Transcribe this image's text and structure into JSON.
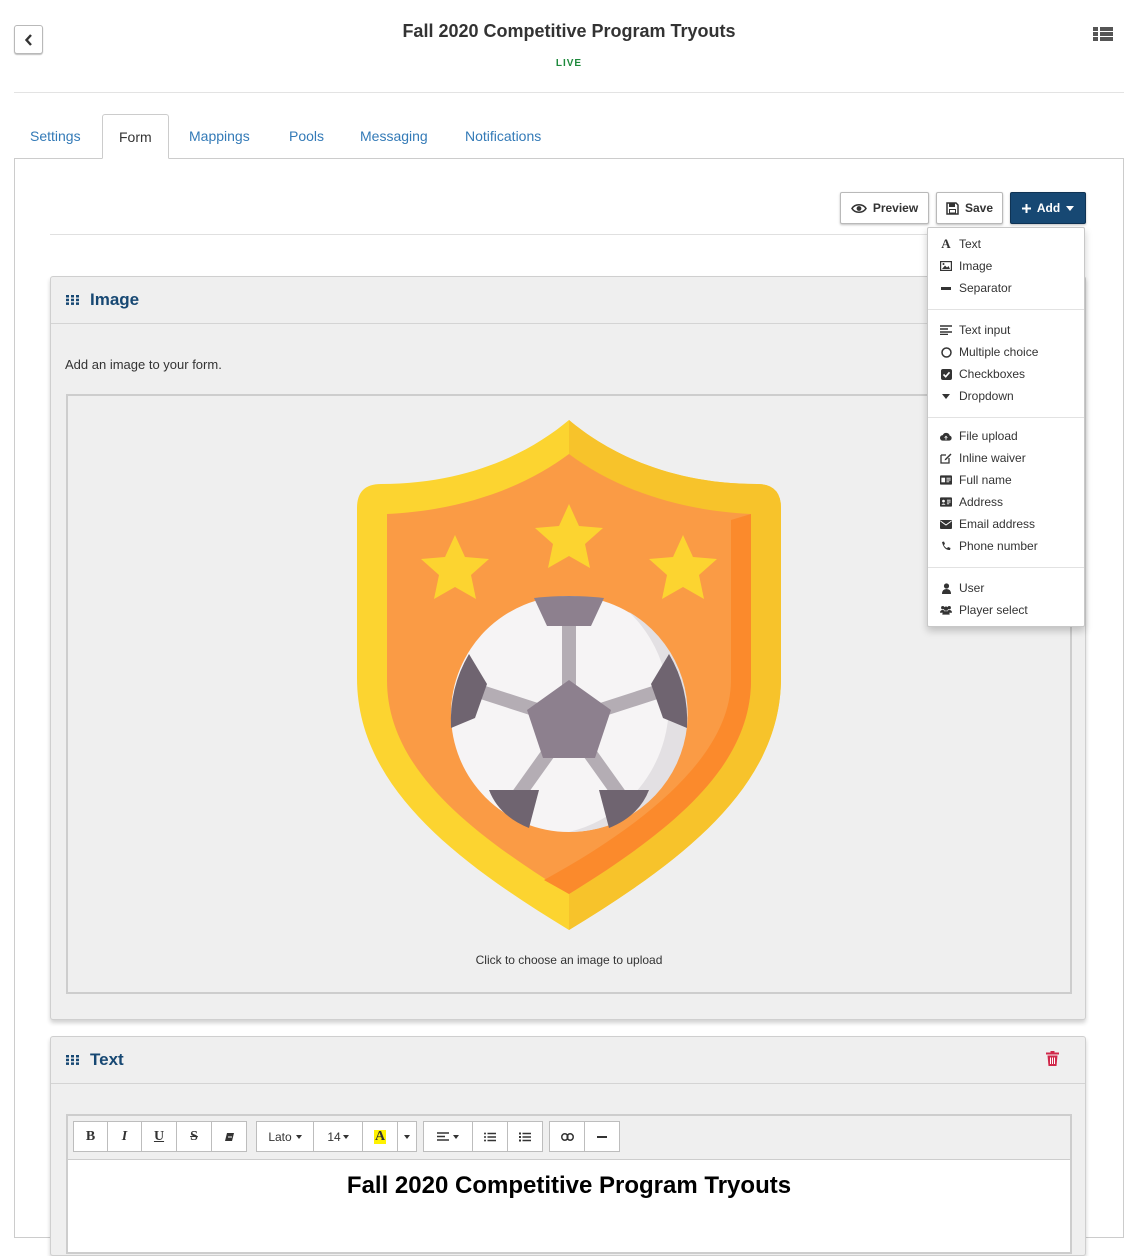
{
  "header": {
    "title": "Fall 2020 Competitive Program Tryouts",
    "status": "LIVE"
  },
  "tabs": [
    {
      "label": "Settings"
    },
    {
      "label": "Form",
      "active": true
    },
    {
      "label": "Mappings"
    },
    {
      "label": "Pools"
    },
    {
      "label": "Messaging"
    },
    {
      "label": "Notifications"
    }
  ],
  "toolbar": {
    "preview_label": "Preview",
    "save_label": "Save",
    "add_label": "Add"
  },
  "add_menu": {
    "groups": [
      [
        {
          "label": "Text",
          "icon": "font-icon"
        },
        {
          "label": "Image",
          "icon": "picture-icon"
        },
        {
          "label": "Separator",
          "icon": "minus-icon"
        }
      ],
      [
        {
          "label": "Text input",
          "icon": "align-left-icon"
        },
        {
          "label": "Multiple choice",
          "icon": "radio-icon"
        },
        {
          "label": "Checkboxes",
          "icon": "check-square-icon"
        },
        {
          "label": "Dropdown",
          "icon": "caret-down-icon"
        }
      ],
      [
        {
          "label": "File upload",
          "icon": "cloud-upload-icon"
        },
        {
          "label": "Inline waiver",
          "icon": "edit-icon"
        },
        {
          "label": "Full name",
          "icon": "id-card-icon"
        },
        {
          "label": "Address",
          "icon": "address-card-icon"
        },
        {
          "label": "Email address",
          "icon": "envelope-icon"
        },
        {
          "label": "Phone number",
          "icon": "phone-icon"
        }
      ],
      [
        {
          "label": "User",
          "icon": "user-icon"
        },
        {
          "label": "Player select",
          "icon": "users-icon"
        }
      ]
    ]
  },
  "image_card": {
    "title": "Image",
    "description": "Add an image to your form.",
    "upload_caption": "Click to choose an image to upload",
    "image_icon": "soccer-shield-badge"
  },
  "text_card": {
    "title": "Text",
    "editor": {
      "font": "Lato",
      "font_size": "14",
      "content_heading": "Fall 2020 Competitive Program Tryouts"
    }
  },
  "colors": {
    "link": "#337ab7",
    "brand": "#174873",
    "live": "#1e8a3c",
    "delete": "#d0284a"
  }
}
